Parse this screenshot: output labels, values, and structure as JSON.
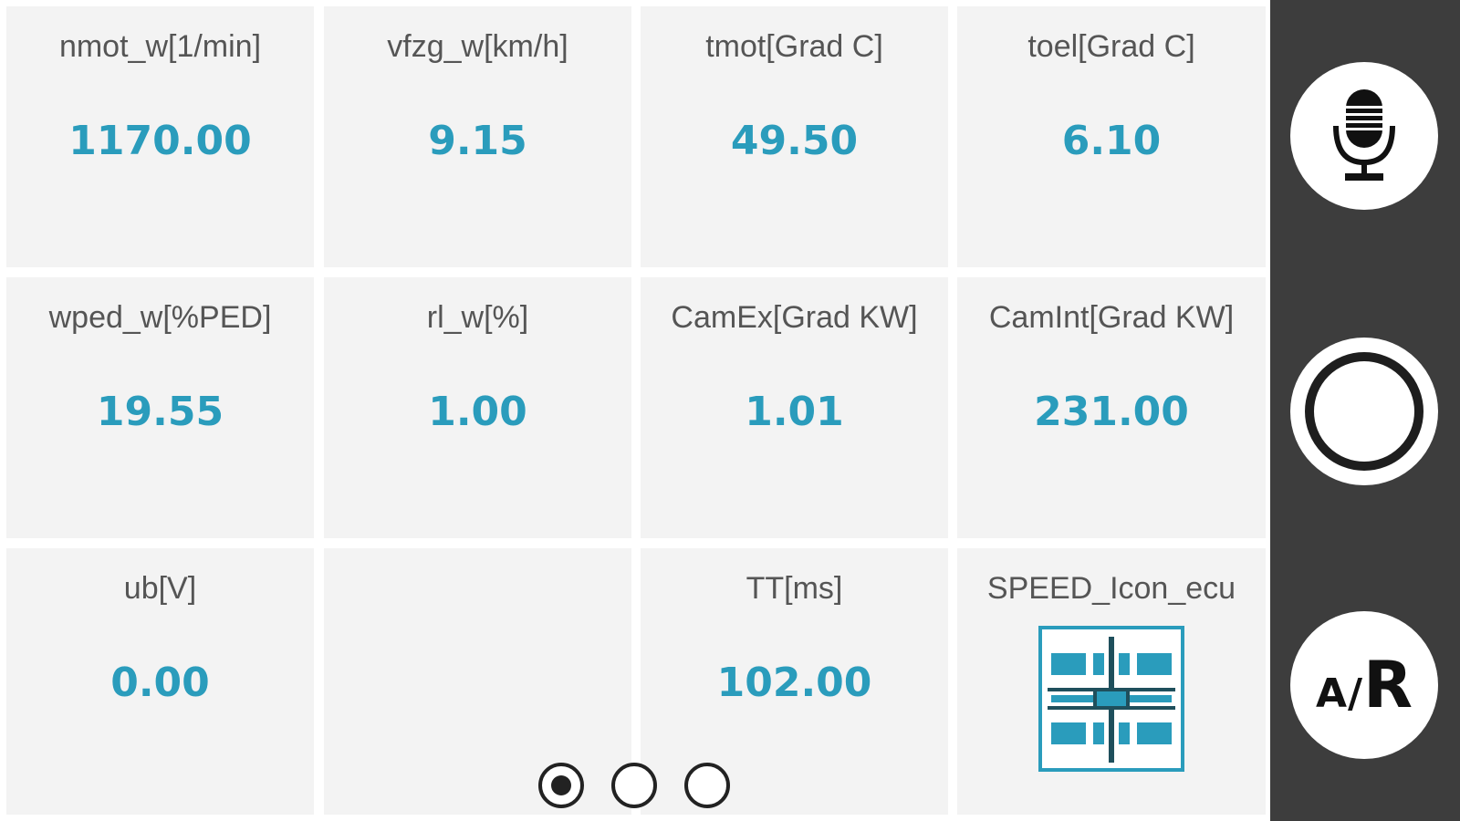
{
  "tiles": [
    {
      "label": "nmot_w[1/min]",
      "value": "1170.00"
    },
    {
      "label": "vfzg_w[km/h]",
      "value": "9.15"
    },
    {
      "label": "tmot[Grad C]",
      "value": "49.50"
    },
    {
      "label": "toel[Grad C]",
      "value": "6.10"
    },
    {
      "label": "wped_w[%PED]",
      "value": "19.55"
    },
    {
      "label": "rl_w[%]",
      "value": "1.00"
    },
    {
      "label": "CamEx[Grad KW]",
      "value": "1.01"
    },
    {
      "label": "CamInt[Grad KW]",
      "value": "231.00"
    },
    {
      "label": "ub[V]",
      "value": "0.00"
    },
    {
      "label": "",
      "value": ""
    },
    {
      "label": "TT[ms]",
      "value": "102.00"
    },
    {
      "label": "SPEED_Icon_ecu",
      "value": ""
    }
  ],
  "ecu_icon": "ecu-chip-icon",
  "pager": {
    "count": 3,
    "active_index": 0
  },
  "side_panel": {
    "mic_icon": "microphone-icon",
    "record_icon": "record-icon",
    "ar_label_a": "A",
    "ar_label_slash": "/",
    "ar_label_r": "R"
  },
  "colors": {
    "value": "#2a9cbc",
    "label": "#555555",
    "tile_bg": "#f3f3f3",
    "panel_bg": "#3d3d3d"
  }
}
